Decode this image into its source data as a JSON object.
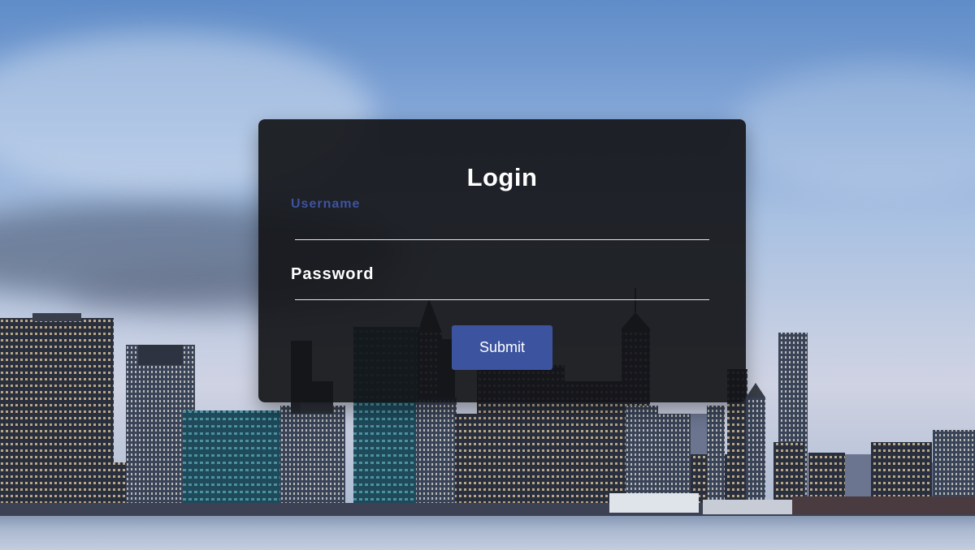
{
  "login_form": {
    "title": "Login",
    "username_label": "Username",
    "username_value": "",
    "password_label": "Password",
    "password_value": "",
    "submit_label": "Submit"
  },
  "colors": {
    "accent": "#3c54a0",
    "card_background": "#141518",
    "text_primary": "#ffffff"
  }
}
